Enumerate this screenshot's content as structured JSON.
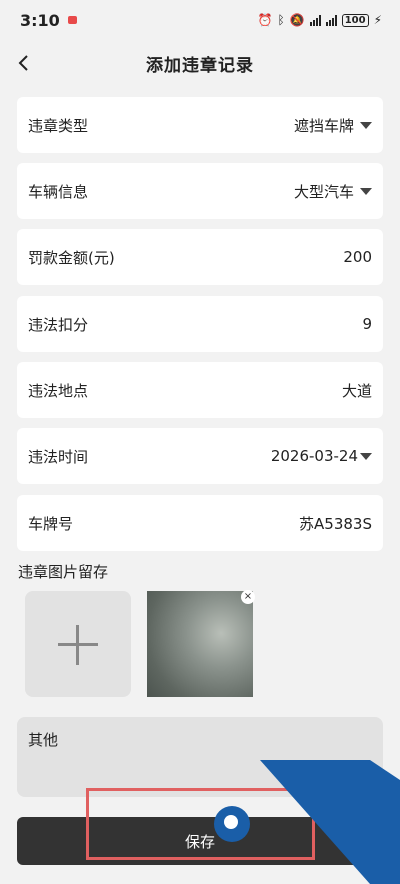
{
  "status_bar": {
    "time": "3:10",
    "battery": "100"
  },
  "header": {
    "title": "添加违章记录"
  },
  "form": [
    {
      "label": "违章类型",
      "value": "遮挡车牌",
      "dropdown": true
    },
    {
      "label": "车辆信息",
      "value": "大型汽车",
      "dropdown": true
    },
    {
      "label": "罚款金额(元)",
      "value": "200",
      "dropdown": false
    },
    {
      "label": "违法扣分",
      "value": "9",
      "dropdown": false
    },
    {
      "label": "违法地点",
      "value": "大道",
      "dropdown": false
    },
    {
      "label": "违法时间",
      "value": "2026-03-24",
      "dropdown": true
    },
    {
      "label": "车牌号",
      "value": "苏A5383S",
      "dropdown": false
    }
  ],
  "photos": {
    "label": "违章图片留存",
    "remove_symbol": "×"
  },
  "other": {
    "label": "其他"
  },
  "save_label": "保存",
  "icons": {
    "back": "chevron-left-icon",
    "caret": "caret-down-icon",
    "add": "plus-icon",
    "close": "close-icon"
  },
  "colors": {
    "background": "#f2f2f2",
    "card": "#ffffff",
    "save_button": "#333333",
    "highlight": "#e06060",
    "watermark_blue": "#1a5ea8"
  }
}
